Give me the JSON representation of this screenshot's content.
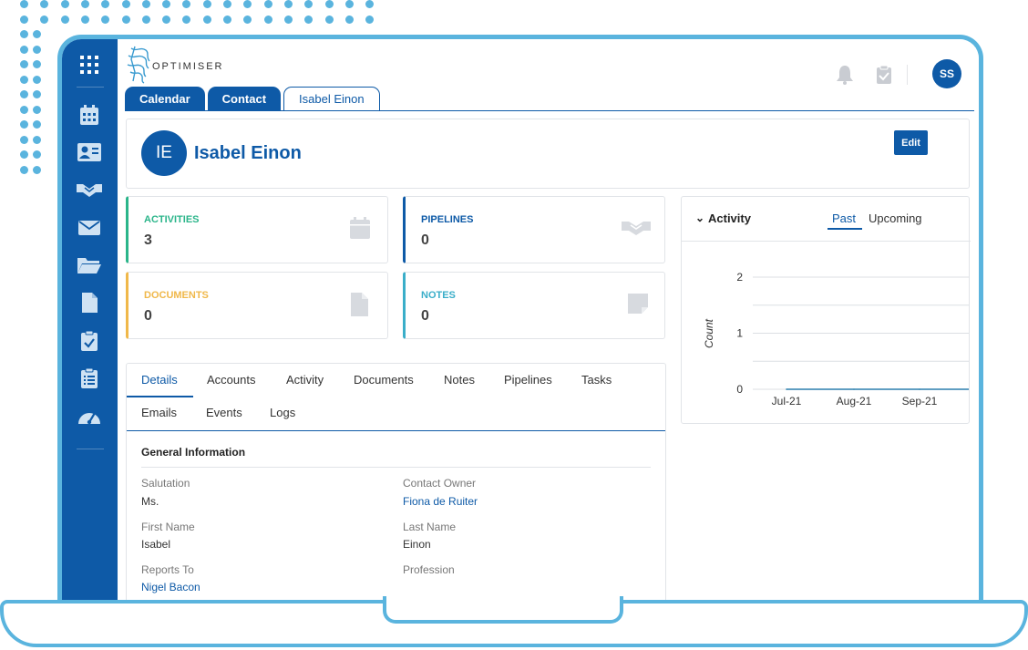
{
  "brand": {
    "name": "OPTIMISER",
    "accent": "#0e5aa7",
    "frame": "#5ab4de"
  },
  "header": {
    "user_initials": "SS",
    "icons": [
      "bell-icon",
      "clipboard-check-icon"
    ]
  },
  "sidebar": {
    "icons": [
      "apps-grid-icon",
      "calendar-icon",
      "contact-card-icon",
      "handshake-icon",
      "mail-icon",
      "folder-icon",
      "document-icon",
      "clipboard-check-icon",
      "clipboard-list-icon",
      "dashboard-gauge-icon"
    ]
  },
  "tabs": [
    {
      "label": "Calendar",
      "active": false
    },
    {
      "label": "Contact",
      "active": false
    },
    {
      "label": "Isabel Einon",
      "active": true
    }
  ],
  "profile": {
    "initials": "IE",
    "name": "Isabel Einon",
    "edit_label": "Edit"
  },
  "stats": [
    {
      "label": "ACTIVITIES",
      "value": "3",
      "color": "#2bb58a",
      "icon": "calendar-icon"
    },
    {
      "label": "PIPELINES",
      "value": "0",
      "color": "#0e5aa7",
      "icon": "handshake-icon"
    },
    {
      "label": "DOCUMENTS",
      "value": "0",
      "color": "#f0b84a",
      "icon": "document-icon"
    },
    {
      "label": "NOTES",
      "value": "0",
      "color": "#3aaec9",
      "icon": "note-icon"
    }
  ],
  "activity": {
    "title": "Activity",
    "tabs": [
      {
        "label": "Past",
        "selected": true
      },
      {
        "label": "Upcoming",
        "selected": false
      }
    ]
  },
  "chart_data": {
    "type": "line",
    "categories": [
      "Jul-21",
      "Aug-21",
      "Sep-21"
    ],
    "series": [
      {
        "values": [
          0,
          0,
          0
        ]
      }
    ],
    "ylabel": "Count",
    "ylim": [
      0,
      2
    ],
    "yticks": [
      "0",
      "1",
      "2"
    ],
    "grid": true
  },
  "details": {
    "tabs": [
      "Details",
      "Accounts",
      "Activity",
      "Documents",
      "Notes",
      "Pipelines",
      "Tasks",
      "Emails",
      "Events",
      "Logs"
    ],
    "selected_tab": "Details",
    "section_title": "General Information",
    "fields": [
      {
        "label": "Salutation",
        "value": "Ms.",
        "link": false
      },
      {
        "label": "Contact Owner",
        "value": "Fiona de Ruiter",
        "link": true
      },
      {
        "label": "First Name",
        "value": "Isabel",
        "link": false
      },
      {
        "label": "Last Name",
        "value": "Einon",
        "link": false
      },
      {
        "label": "Reports To",
        "value": "Nigel Bacon",
        "link": true
      },
      {
        "label": "Profession",
        "value": "",
        "link": false
      }
    ]
  }
}
